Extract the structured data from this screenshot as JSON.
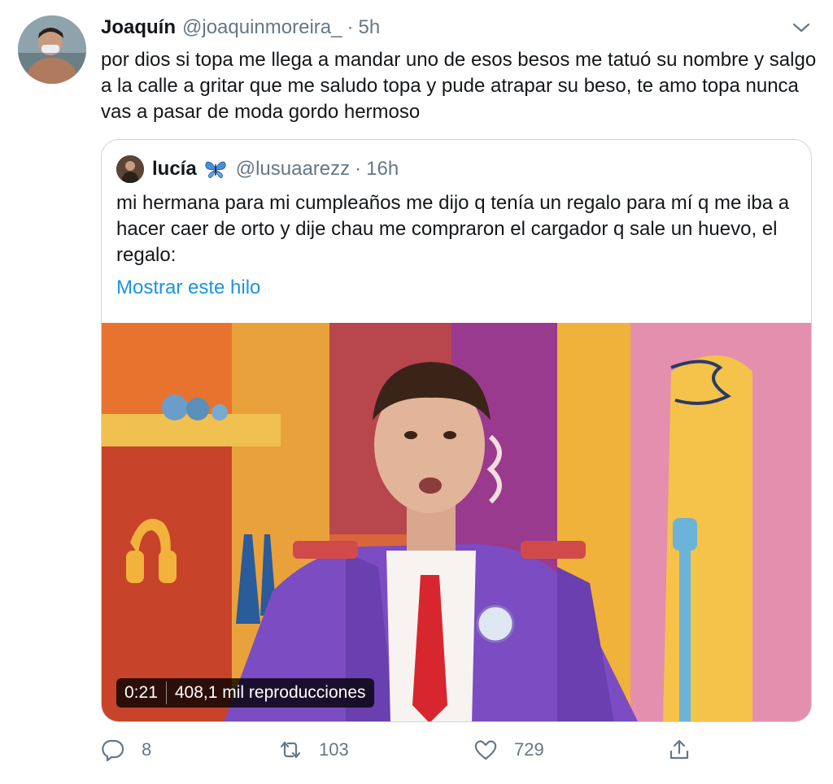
{
  "tweet": {
    "author": {
      "name": "Joaquín",
      "handle": "@joaquinmoreira_",
      "separator": "·",
      "time": "5h",
      "avatar_icon": "user-avatar"
    },
    "text": "por dios si topa me llega a mandar uno de esos besos me tatuó su nombre y salgo a la calle a gritar que me saludo topa y pude atrapar su beso, te amo topa nunca vas a pasar de moda gordo hermoso",
    "menu_icon": "chevron-down-icon"
  },
  "quoted_tweet": {
    "author": {
      "name": "lucía",
      "emoji_icon": "butterfly-icon",
      "handle": "@lusuaarezz",
      "separator": "·",
      "time": "16h"
    },
    "text": "mi hermana para mi cumpleaños me dijo q tenía un regalo para mí q me iba a hacer caer de orto y dije chau me compraron el cargador q sale un huevo, el regalo:",
    "thread_link": "Mostrar este hilo",
    "video": {
      "duration": "0:21",
      "views": "408,1 mil reproducciones"
    }
  },
  "actions": {
    "reply": {
      "icon": "reply-icon",
      "count": "8"
    },
    "retweet": {
      "icon": "retweet-icon",
      "count": "103"
    },
    "like": {
      "icon": "heart-icon",
      "count": "729"
    },
    "share": {
      "icon": "share-icon"
    }
  },
  "colors": {
    "text_primary": "#14171a",
    "text_secondary": "#657786",
    "link": "#1b95e0",
    "border": "#ccd6dd"
  }
}
